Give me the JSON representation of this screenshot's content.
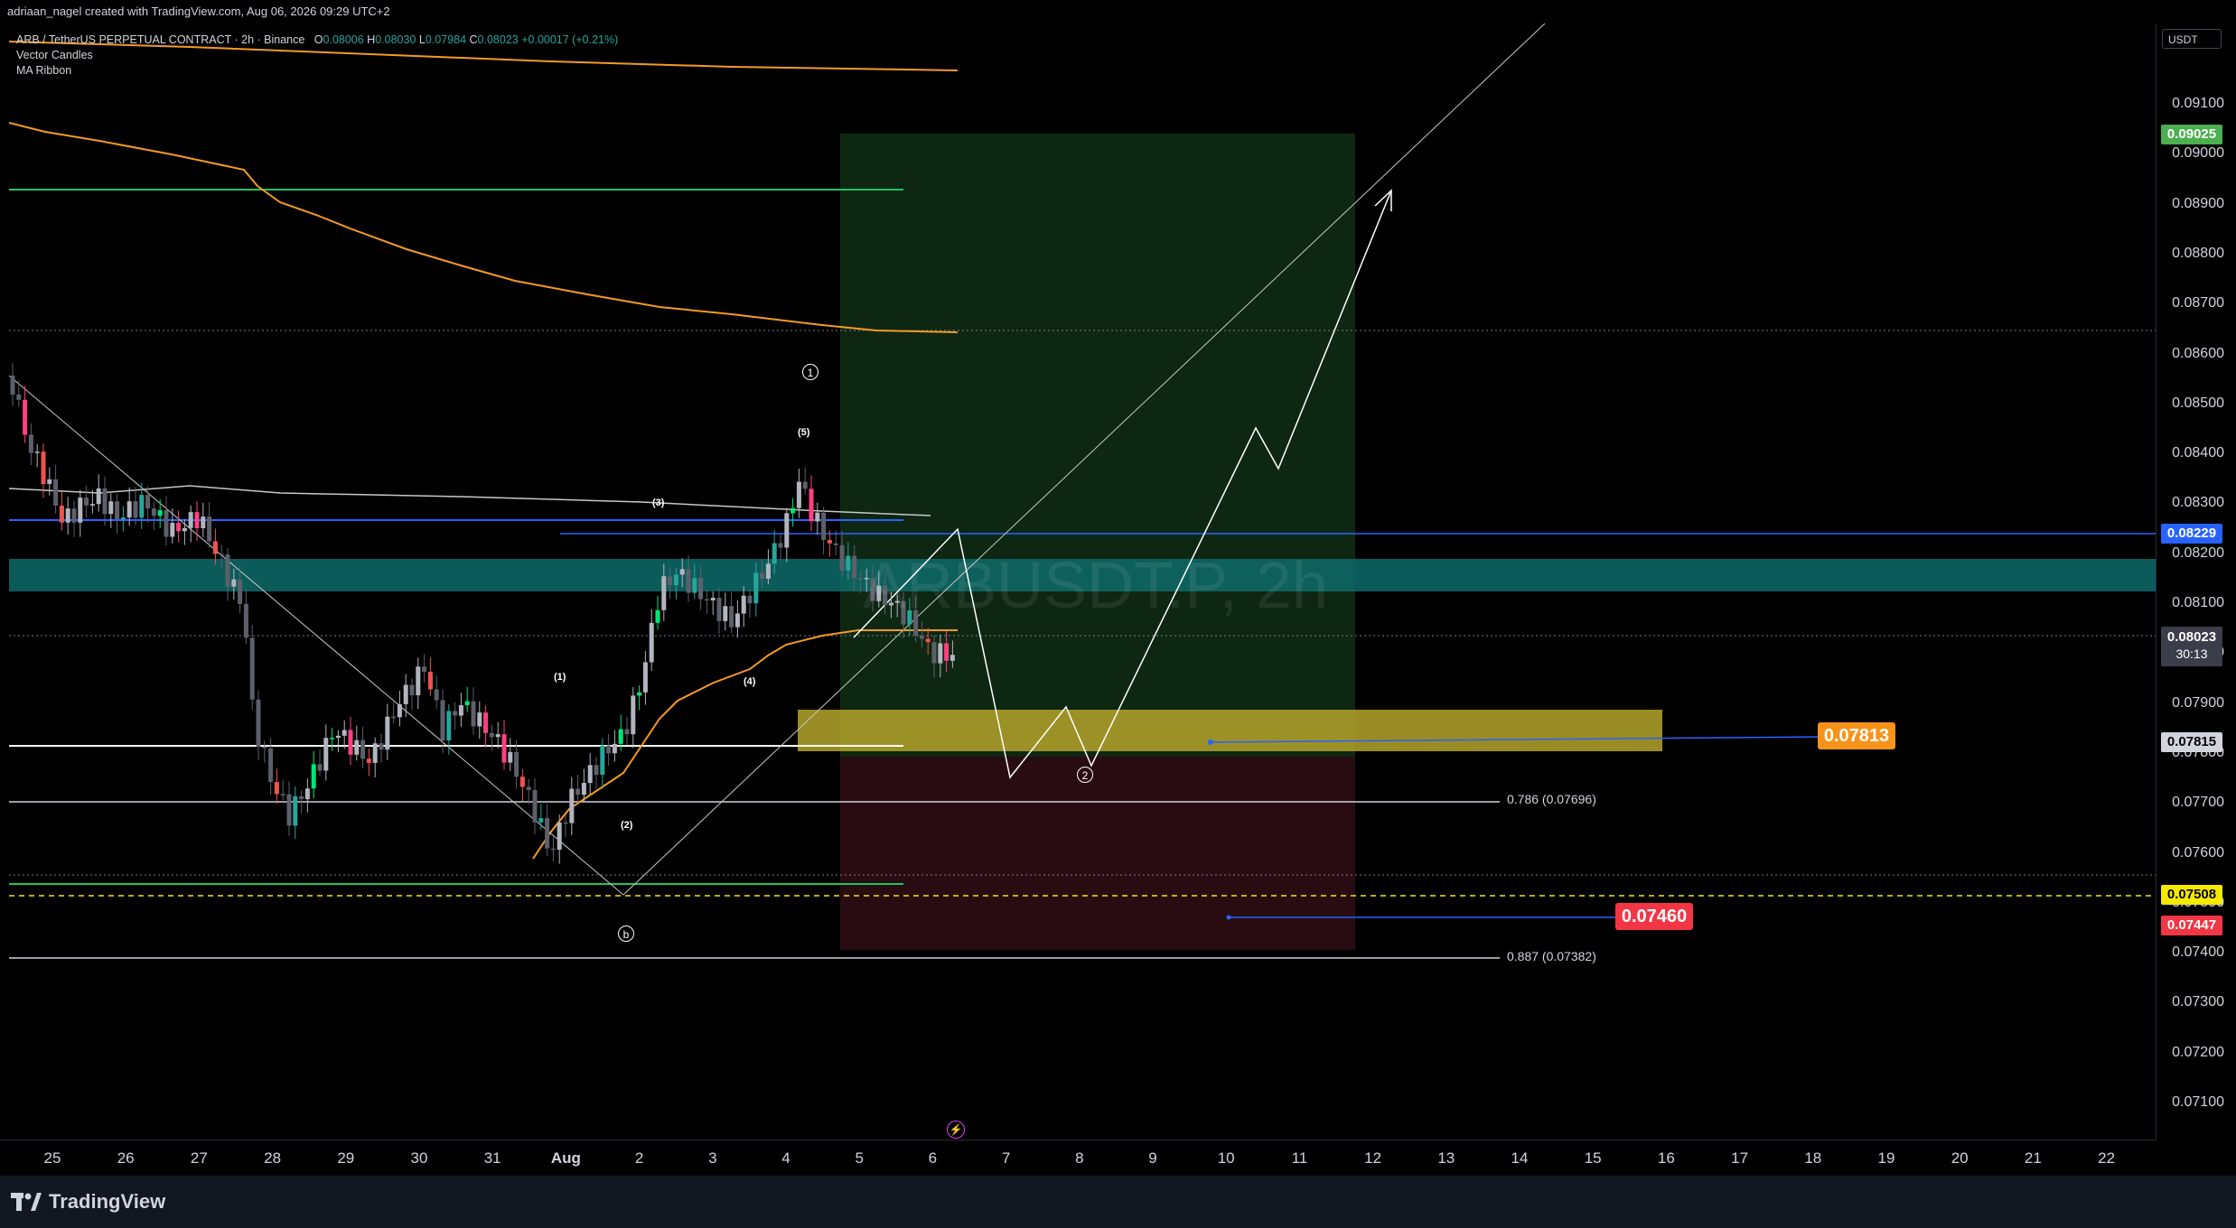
{
  "header": {
    "attribution": "adriaan_nagel created with TradingView.com, Aug 06, 2026 09:29 UTC+2"
  },
  "legend": {
    "symbol_line": "ARB / TetherUS PERPETUAL CONTRACT · 2h · Binance",
    "ohlc": {
      "open_label": "O",
      "open": "0.08006",
      "high_label": "H",
      "high": "0.08030",
      "low_label": "L",
      "low": "0.07984",
      "close_label": "C",
      "close": "0.08023",
      "change": "+0.00017 (+0.21%)"
    },
    "indicators": [
      "Vector Candles",
      "MA Ribbon"
    ]
  },
  "watermark": "ARBUSDT.P, 2h",
  "price_axis": {
    "currency": "USDT",
    "labels": [
      "0.09100",
      "0.09000",
      "0.08900",
      "0.08800",
      "0.08700",
      "0.08600",
      "0.08500",
      "0.08400",
      "0.08300",
      "0.08200",
      "0.08100",
      "0.08000",
      "0.07900",
      "0.07800",
      "0.07700",
      "0.07600",
      "0.07500",
      "0.07400",
      "0.07300",
      "0.07200",
      "0.07100"
    ],
    "badges": [
      {
        "text": "0.09025",
        "bg": "#4caf50",
        "fg": "#ffffff"
      },
      {
        "text": "0.08229",
        "bg": "#2962ff",
        "fg": "#ffffff"
      },
      {
        "text": "0.08023",
        "sub": "30:13",
        "bg": "#3a3e4a",
        "fg": "#ffffff"
      },
      {
        "text": "0.07815",
        "bg": "#d1d4dc",
        "fg": "#000000"
      },
      {
        "text": "0.07508",
        "bg": "#f5e900",
        "fg": "#000000"
      },
      {
        "text": "0.07447",
        "bg": "#f23645",
        "fg": "#ffffff"
      }
    ]
  },
  "time_axis": {
    "labels": [
      "25",
      "26",
      "27",
      "28",
      "29",
      "30",
      "31",
      "Aug",
      "2",
      "3",
      "4",
      "5",
      "6",
      "7",
      "8",
      "9",
      "10",
      "11",
      "12",
      "13",
      "14",
      "15",
      "16",
      "17",
      "18",
      "19",
      "20",
      "21",
      "22"
    ]
  },
  "annotations": {
    "target_label": "0.07813",
    "stop_label": "0.07460",
    "fib_786": "0.786 (0.07696)",
    "fib_887": "0.887 (0.07382)",
    "waves": [
      "(1)",
      "(2)",
      "(3)",
      "(4)",
      "(5)"
    ],
    "circles": [
      "1",
      "2",
      "b"
    ]
  },
  "colors": {
    "accent_orange": "#f7931a",
    "ma_orange": "#f59a23",
    "green_line": "#22c55e",
    "blue_line": "#2962ff",
    "teal_zone": "#0e6b6b",
    "yellow_zone": "#b5a52a"
  },
  "footer": {
    "brand": "TradingView"
  }
}
